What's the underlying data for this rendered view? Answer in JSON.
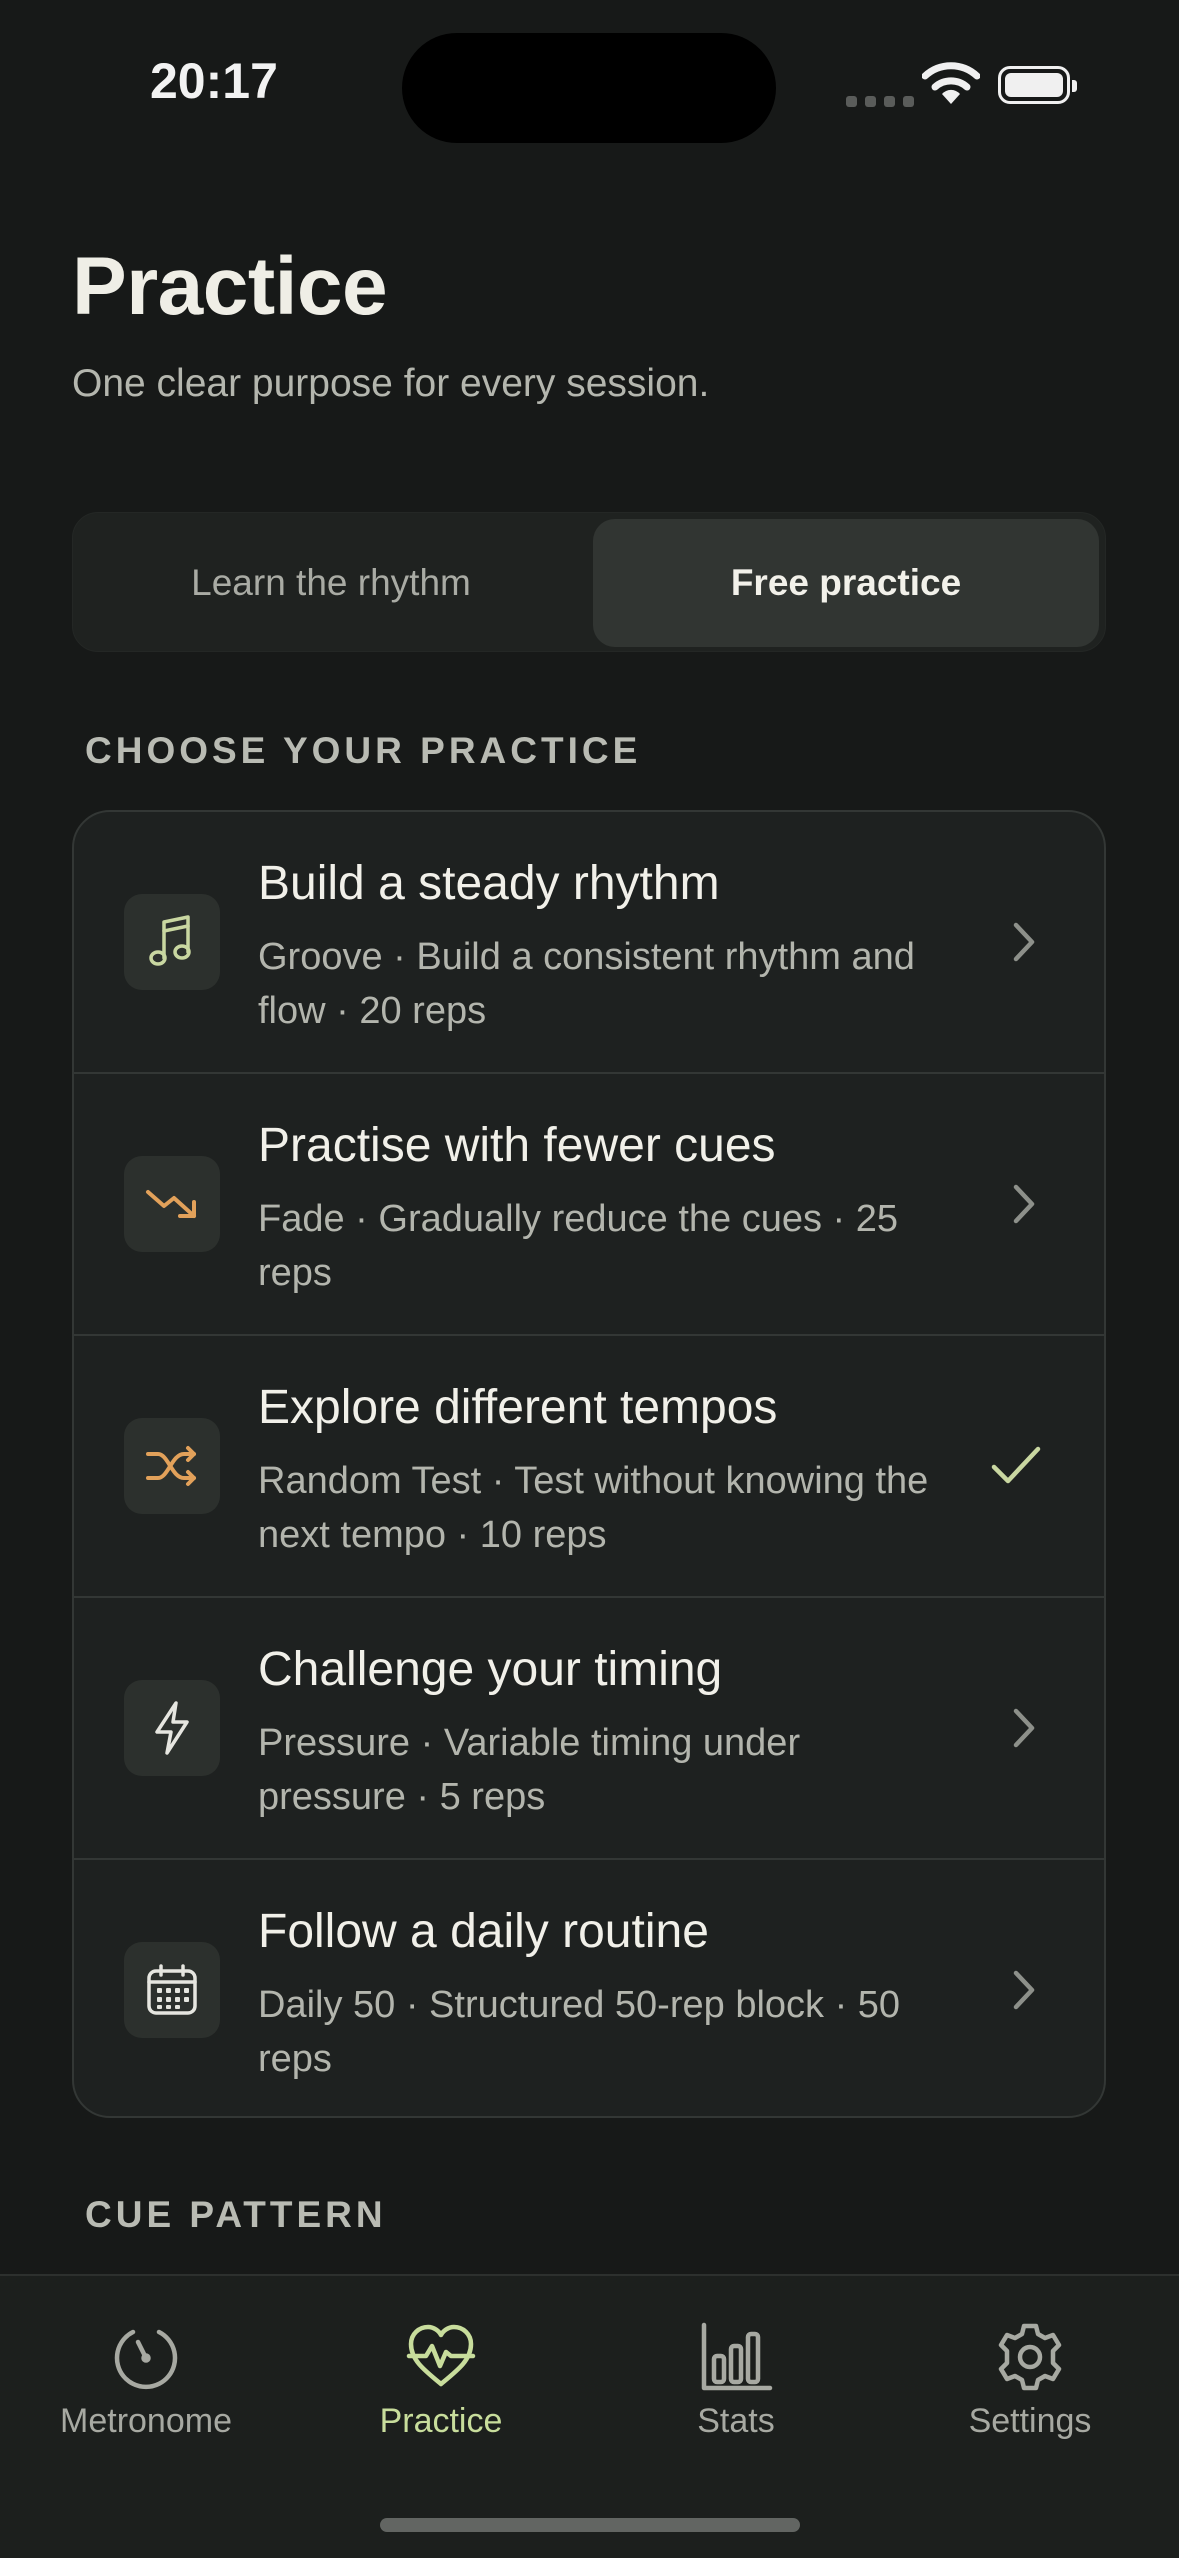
{
  "status_bar": {
    "time": "20:17"
  },
  "header": {
    "title": "Practice",
    "subtitle": "One clear purpose for every session."
  },
  "segmented": {
    "options": [
      "Learn the rhythm",
      "Free practice"
    ],
    "selected": "Free practice"
  },
  "sections": {
    "choose": "CHOOSE YOUR PRACTICE",
    "cue": "CUE PATTERN"
  },
  "practices": [
    {
      "title": "Build a steady rhythm",
      "description": "Groove · Build a consistent rhythm and flow · 20 reps",
      "icon": "music-note-icon",
      "trailing": "chevron-right-icon",
      "selected": false
    },
    {
      "title": "Practise with fewer cues",
      "description": "Fade · Gradually reduce the cues · 25 reps",
      "icon": "trend-down-icon",
      "trailing": "chevron-right-icon",
      "selected": false
    },
    {
      "title": "Explore different tempos",
      "description": "Random Test · Test without knowing the next tempo · 10 reps",
      "icon": "shuffle-icon",
      "trailing": "checkmark-icon",
      "selected": true
    },
    {
      "title": "Challenge your timing",
      "description": "Pressure · Variable timing under pressure · 5 reps",
      "icon": "lightning-icon",
      "trailing": "chevron-right-icon",
      "selected": false
    },
    {
      "title": "Follow a daily routine",
      "description": "Daily 50 · Structured 50-rep block · 50 reps",
      "icon": "calendar-icon",
      "trailing": "chevron-right-icon",
      "selected": false
    }
  ],
  "tabbar": {
    "tabs": [
      {
        "label": "Metronome",
        "icon": "metronome-icon"
      },
      {
        "label": "Practice",
        "icon": "heart-pulse-icon"
      },
      {
        "label": "Stats",
        "icon": "bar-chart-icon"
      },
      {
        "label": "Settings",
        "icon": "gear-icon"
      }
    ],
    "active": "Practice"
  },
  "colors": {
    "background": "#171918",
    "accent": "#c8dd9c",
    "icon_orange": "#e2a15a",
    "icon_green": "#c9d7a1"
  }
}
